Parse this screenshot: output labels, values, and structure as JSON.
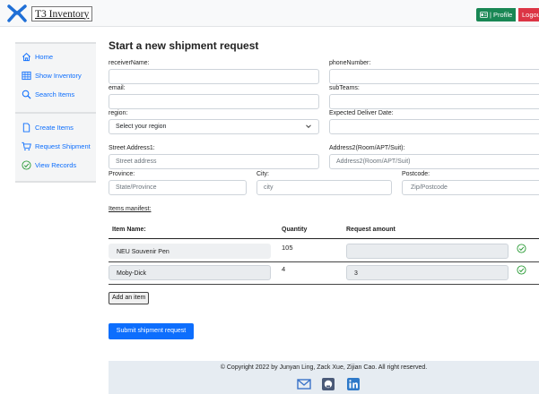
{
  "header": {
    "brand": "T3 Inventory",
    "profile_label": "| Profile",
    "logout_label": "Logout"
  },
  "sidebar": {
    "items": [
      {
        "label": "Home",
        "icon": "home-icon"
      },
      {
        "label": "Show Inventory",
        "icon": "table-icon"
      },
      {
        "label": "Search Items",
        "icon": "search-icon"
      },
      {
        "label": "Create Items",
        "icon": "file-icon"
      },
      {
        "label": "Request Shipment",
        "icon": "cart-icon"
      },
      {
        "label": "View Records",
        "icon": "check-circle-icon"
      }
    ]
  },
  "form": {
    "title": "Start a new shipment request",
    "receiver_label": "receiverName:",
    "phone_label": "phoneNumber:",
    "email_label": "email:",
    "subteams_label": "subTeams:",
    "region_label": "region:",
    "region_value": "Select your region",
    "deliver_label": "Expected Deliver Date:",
    "street1_label": "Street Address1:",
    "street1_placeholder": "Street address",
    "street2_label": "Address2(Room/APT/Suit):",
    "street2_placeholder": "Address2(Room/APT/Suit)",
    "province_label": "Province:",
    "province_placeholder": "State/Province",
    "city_label": "City:",
    "city_placeholder": "city",
    "postcode_label": "Postcode:",
    "postcode_placeholder": "Zip/Postcode"
  },
  "manifest": {
    "title": "Items manifest:",
    "headers": [
      "Item Name:",
      "Quantity",
      "Request amount"
    ],
    "rows": [
      {
        "name": "NEU Souvenir Pen",
        "quantity": "105",
        "request": ""
      },
      {
        "name": "Moby-Dick",
        "quantity": "4",
        "request": "3"
      }
    ],
    "add_label": "Add an item",
    "submit_label": "Submit shipment request"
  },
  "footer": {
    "copyright": "© Copyright 2022 by Junyan Ling, Zack Xue, Zijian Cao. All right reserved.",
    "icons": [
      "mail-icon",
      "github-icon",
      "linkedin-icon"
    ]
  },
  "colors": {
    "primary": "#0d6efd",
    "success": "#198754",
    "danger": "#dc3545",
    "check": "#2e9d3a",
    "footer_bg": "#e6ecf2"
  }
}
